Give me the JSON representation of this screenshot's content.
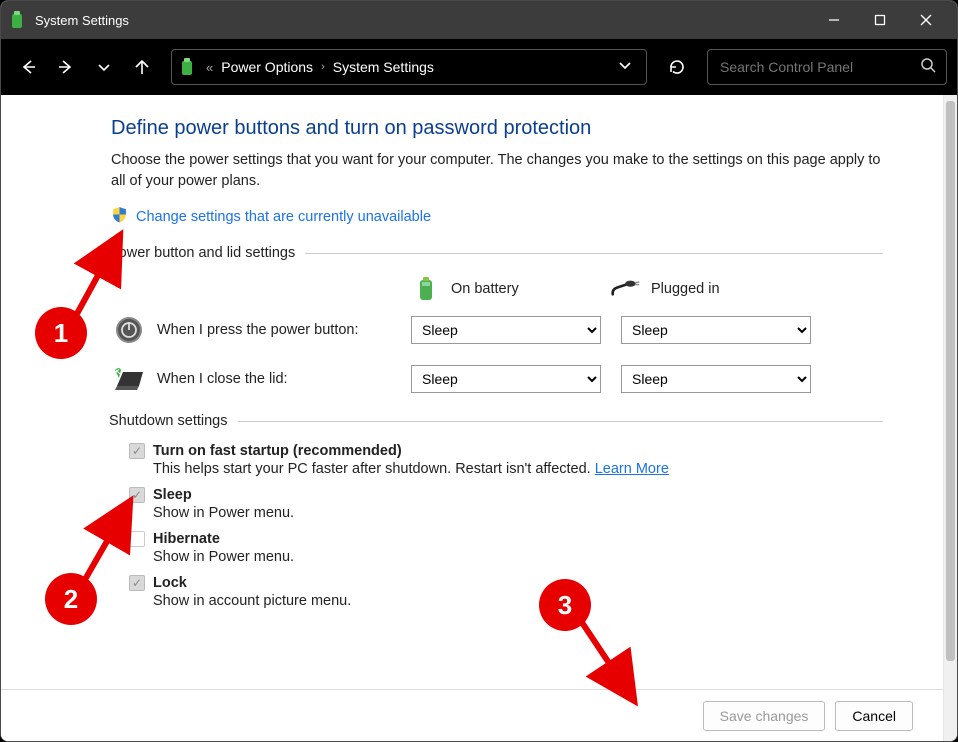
{
  "window": {
    "title": "System Settings"
  },
  "breadcrumb": {
    "parent": "Power Options",
    "current": "System Settings"
  },
  "search": {
    "placeholder": "Search Control Panel"
  },
  "page": {
    "heading": "Define power buttons and turn on password protection",
    "intro": "Choose the power settings that you want for your computer. The changes you make to the settings on this page apply to all of your power plans.",
    "change_link": "Change settings that are currently unavailable"
  },
  "sections": {
    "power_button": "Power button and lid settings",
    "shutdown": "Shutdown settings"
  },
  "columns": {
    "battery": "On battery",
    "plugged": "Plugged in"
  },
  "rows": {
    "power_button": {
      "label": "When I press the power button:",
      "battery": "Sleep",
      "plugged": "Sleep"
    },
    "lid": {
      "label": "When I close the lid:",
      "battery": "Sleep",
      "plugged": "Sleep"
    }
  },
  "shutdown": {
    "fast": {
      "label": "Turn on fast startup (recommended)",
      "desc": "This helps start your PC faster after shutdown. Restart isn't affected. ",
      "learn": "Learn More"
    },
    "sleep": {
      "label": "Sleep",
      "desc": "Show in Power menu."
    },
    "hibernate": {
      "label": "Hibernate",
      "desc": "Show in Power menu."
    },
    "lock": {
      "label": "Lock",
      "desc": "Show in account picture menu."
    }
  },
  "footer": {
    "save": "Save changes",
    "cancel": "Cancel"
  },
  "annotations": {
    "a1": "1",
    "a2": "2",
    "a3": "3"
  }
}
